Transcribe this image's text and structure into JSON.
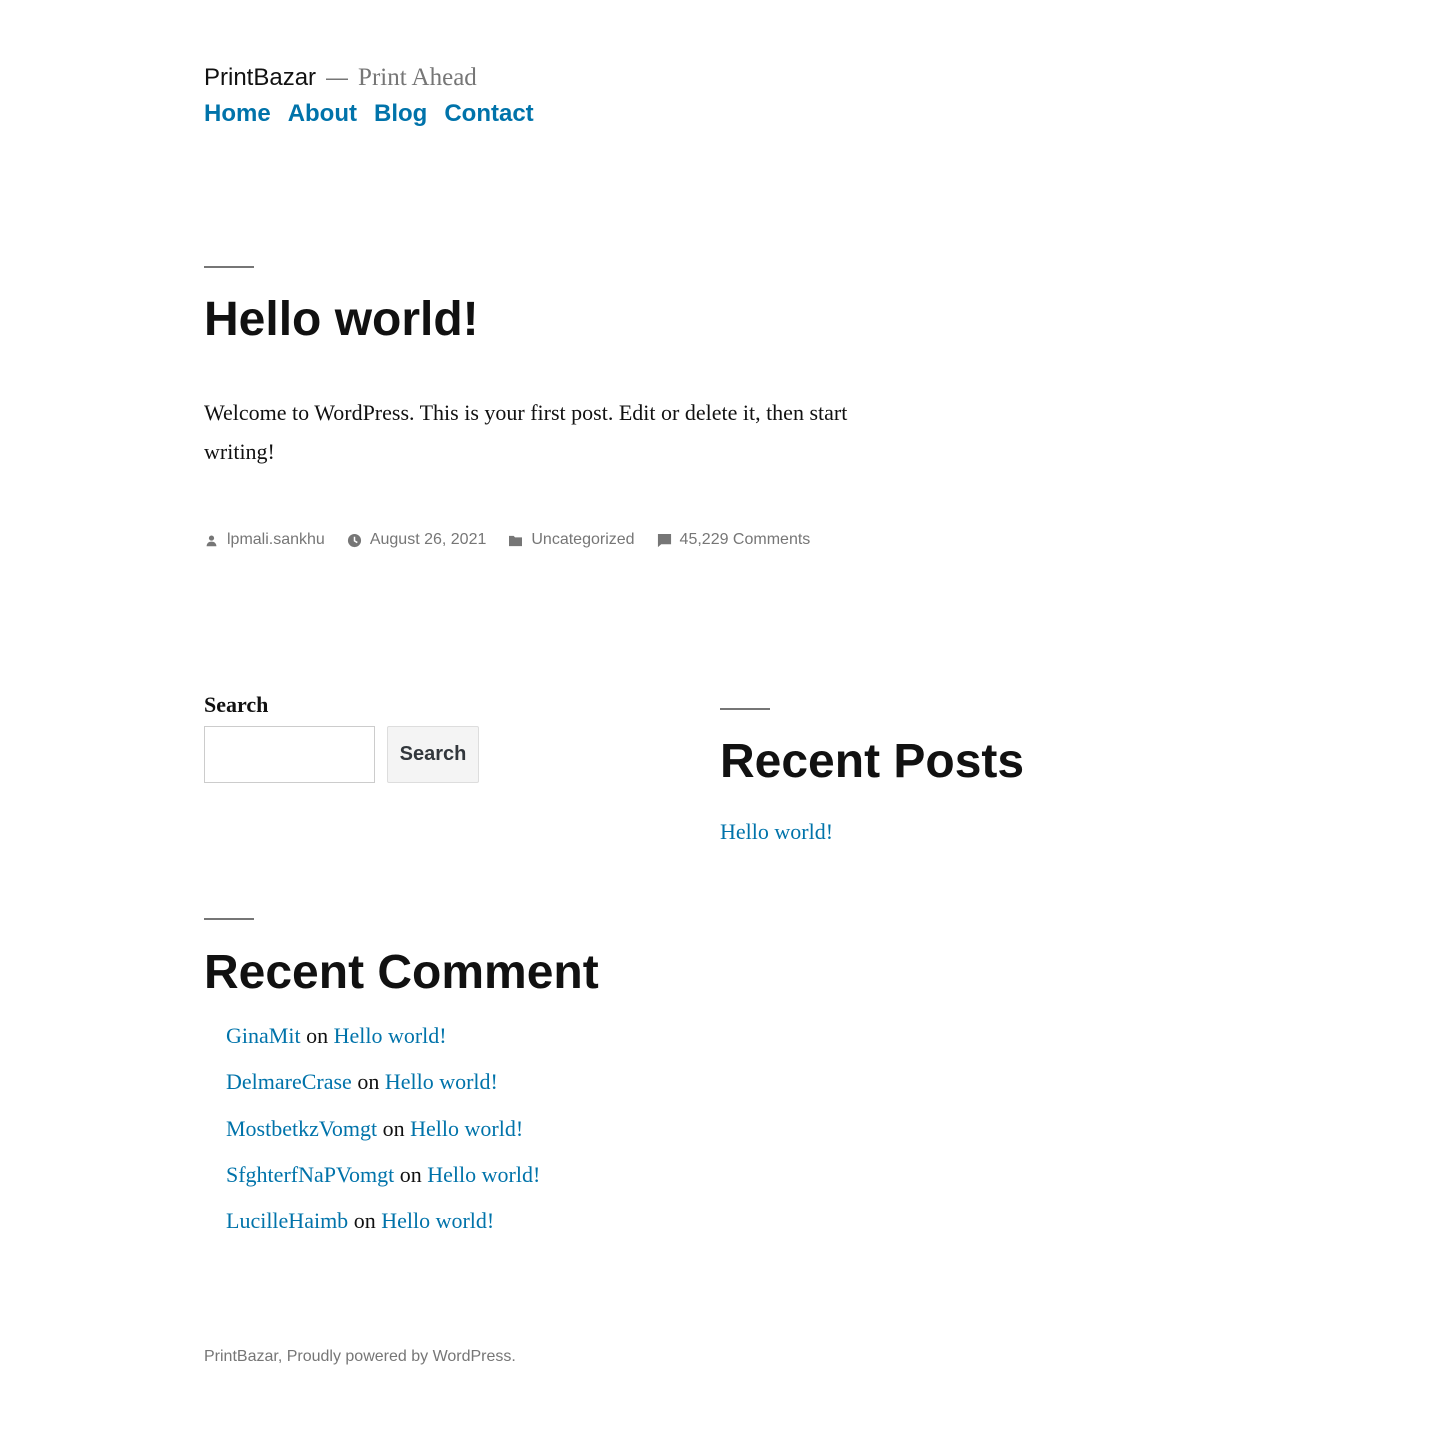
{
  "header": {
    "site_name": "PrintBazar",
    "separator": "—",
    "tagline": "Print Ahead",
    "nav": [
      "Home",
      "About",
      "Blog",
      "Contact"
    ]
  },
  "post": {
    "title": "Hello world!",
    "body": "Welcome to WordPress. This is your first post. Edit or delete it, then start writing!",
    "meta": {
      "author": "lpmali.sankhu",
      "author_icon": "person-icon",
      "date": "August 26, 2021",
      "date_icon": "clock-icon",
      "category": "Uncategorized",
      "category_icon": "folder-icon",
      "comments": "45,229 Comments",
      "comments_icon": "comment-icon"
    }
  },
  "search_widget": {
    "heading": "Search",
    "input_value": "",
    "button_label": "Search"
  },
  "recent_posts": {
    "title": "Recent Posts",
    "items": [
      "Hello world!"
    ]
  },
  "recent_comments": {
    "title": "Recent Comment",
    "items": [
      {
        "author": "GinaMit",
        "on": "on",
        "post": "Hello world!"
      },
      {
        "author": "DelmareCrase",
        "on": "on",
        "post": "Hello world!"
      },
      {
        "author": "MostbetkzVomgt",
        "on": "on",
        "post": "Hello world!"
      },
      {
        "author": "SfghterfNaPVomgt",
        "on": "on",
        "post": "Hello world!"
      },
      {
        "author": "LucilleHaimb",
        "on": "on",
        "post": "Hello world!"
      }
    ]
  },
  "footer": {
    "site_link": "PrintBazar",
    "sep": ", ",
    "powered_by": "Proudly powered by WordPress."
  },
  "colors": {
    "link": "#0073aa",
    "text": "#111111",
    "muted": "#767676",
    "background": "#ffffff"
  }
}
